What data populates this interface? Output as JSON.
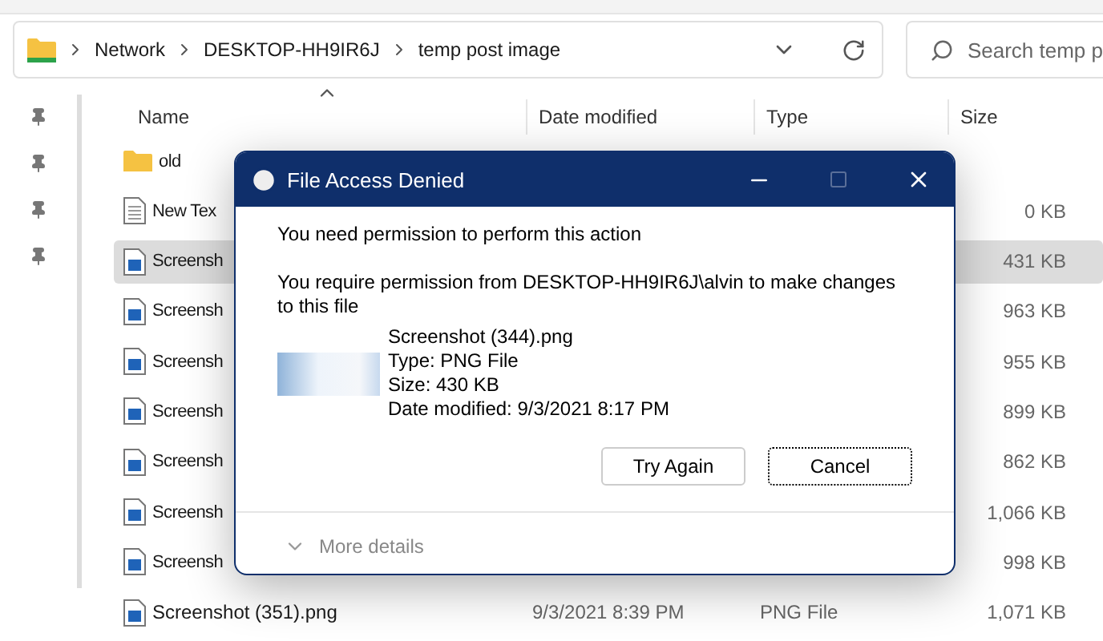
{
  "address_bar": {
    "crumbs": [
      "Network",
      "DESKTOP-HH9IR6J",
      "temp post image"
    ]
  },
  "search": {
    "placeholder": "Search temp p"
  },
  "columns": [
    "Name",
    "Date modified",
    "Type",
    "Size"
  ],
  "rows": [
    {
      "kind": "folder",
      "name": "old",
      "selected": false
    },
    {
      "kind": "text",
      "name": "New Tex",
      "size": "0 KB",
      "selected": false
    },
    {
      "kind": "image",
      "name": "Screensh",
      "size": "431 KB",
      "selected": true
    },
    {
      "kind": "image",
      "name": "Screensh",
      "size": "963 KB",
      "selected": false
    },
    {
      "kind": "image",
      "name": "Screensh",
      "size": "955 KB",
      "selected": false
    },
    {
      "kind": "image",
      "name": "Screensh",
      "size": "899 KB",
      "selected": false
    },
    {
      "kind": "image",
      "name": "Screensh",
      "size": "862 KB",
      "selected": false
    },
    {
      "kind": "image",
      "name": "Screensh",
      "size": "1,066 KB",
      "selected": false
    },
    {
      "kind": "image",
      "name": "Screensh",
      "size": "998 KB",
      "selected": false
    },
    {
      "kind": "image",
      "name": "Screenshot (351).png",
      "date": "9/3/2021 8:39 PM",
      "type": "PNG File",
      "size": "1,071 KB",
      "selected": false
    }
  ],
  "dialog": {
    "title": "File Access Denied",
    "heading": "You need permission to perform this action",
    "message": "You require permission from DESKTOP-HH9IR6J\\alvin to make changes to this file",
    "file": {
      "name": "Screenshot (344).png",
      "type": "Type: PNG File",
      "size": "Size: 430 KB",
      "date": "Date modified: 9/3/2021 8:17 PM"
    },
    "buttons": [
      {
        "label": "Try Again",
        "focused": false
      },
      {
        "label": "Cancel",
        "focused": true
      }
    ],
    "more_details": "More details"
  }
}
